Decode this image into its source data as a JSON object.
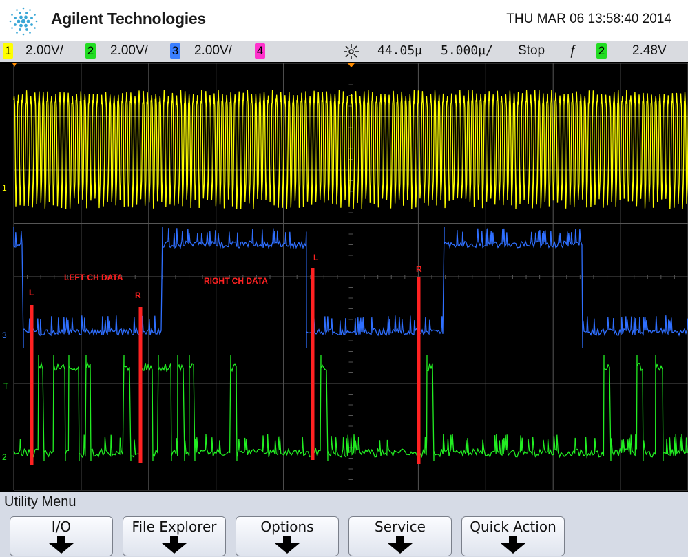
{
  "header": {
    "brand": "Agilent Technologies",
    "datetime": "THU MAR 06 13:58:40 2014"
  },
  "status": {
    "ch1": {
      "num": "1",
      "scale": "2.00V/",
      "color": "#ffff00"
    },
    "ch2": {
      "num": "2",
      "scale": "2.00V/",
      "color": "#22dd22"
    },
    "ch3": {
      "num": "3",
      "scale": "2.00V/",
      "color": "#3a7fff"
    },
    "ch4": {
      "num": "4",
      "color": "#ff33cc"
    },
    "delay": "44.05µ",
    "timebase": "5.000µ/",
    "run_state": "Stop",
    "trigger_slope": "ƒ",
    "trigger_source": "2",
    "trigger_level": "2.48V"
  },
  "display": {
    "markers": {
      "ch1": "1",
      "ch3": "3",
      "trigger": "T",
      "ch2": "2"
    },
    "annotations": {
      "left_ch_data": "LEFT CH DATA",
      "right_ch_data": "RIGHT CH DATA",
      "l1": "L",
      "r1": "R",
      "l2": "L",
      "r2": "R"
    },
    "colors": {
      "ch1": "#ffff00",
      "ch2": "#22ee22",
      "ch3": "#2f6fff",
      "annotation": "#ff2222",
      "grid": "#555555"
    }
  },
  "menu": {
    "title": "Utility Menu",
    "softkeys": [
      "I/O",
      "File Explorer",
      "Options",
      "Service",
      "Quick Action"
    ]
  }
}
